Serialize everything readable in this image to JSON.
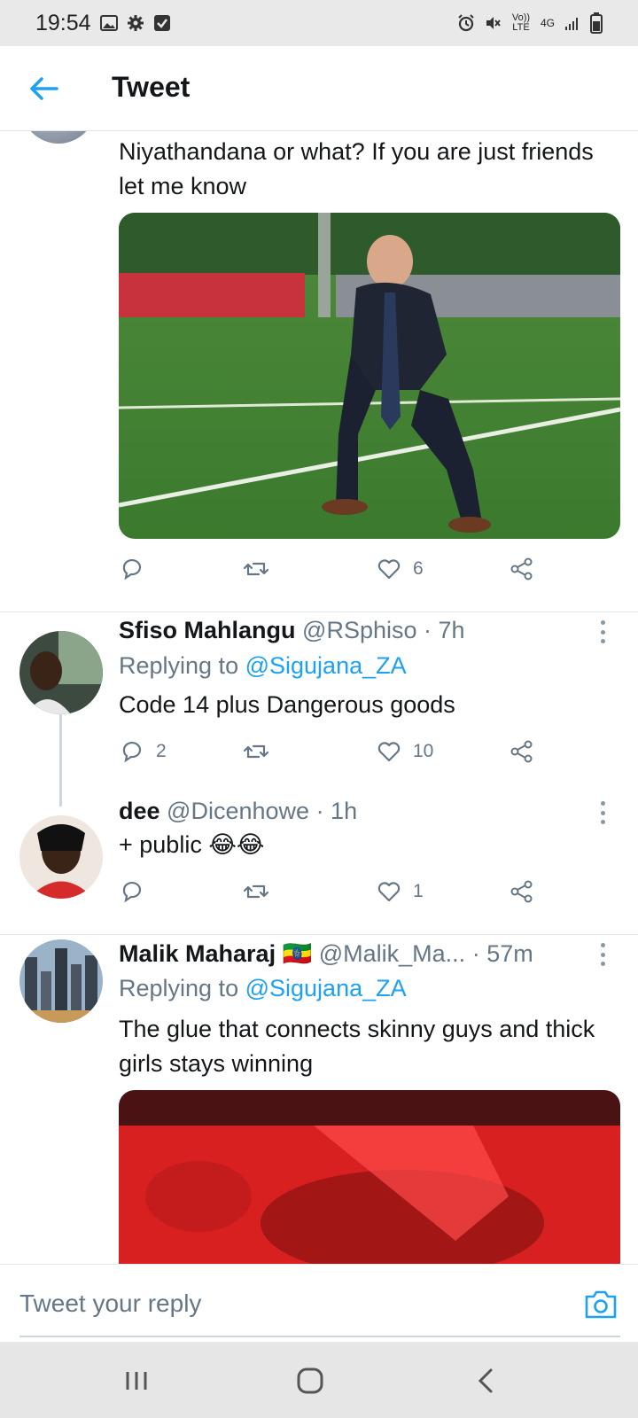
{
  "status_bar": {
    "time": "19:54",
    "network": "4G",
    "volte": "Vo)) LTE",
    "icons": [
      "image-icon",
      "gear-icon",
      "check-box-icon",
      "alarm-icon",
      "mute-icon",
      "signal-icon",
      "battery-icon"
    ]
  },
  "header": {
    "title": "Tweet",
    "back_icon": "arrow-left-icon",
    "accent": "#1da1f2"
  },
  "tweets": [
    {
      "text": "Niyathandana or what? If you are just friends let me know",
      "has_media": true,
      "reply_count": "",
      "retweet_count": "",
      "like_count": "6"
    },
    {
      "name": "Sfiso Mahlangu",
      "handle": "@RSphiso",
      "time": "· 7h",
      "replying_prefix": "Replying to",
      "replying_to": "@Sigujana_ZA",
      "text": "Code 14 plus Dangerous goods",
      "reply_count": "2",
      "retweet_count": "",
      "like_count": "10"
    },
    {
      "name": "dee",
      "handle": "@Dicenhowe",
      "time": "· 1h",
      "text": "+ public 😂😂",
      "reply_count": "",
      "retweet_count": "",
      "like_count": "1"
    },
    {
      "name": "Malik Maharaj",
      "flag": "🇪🇹",
      "handle": "@Malik_Ma...",
      "time": "· 57m",
      "replying_prefix": "Replying to",
      "replying_to": "@Sigujana_ZA",
      "text": "The glue that connects skinny guys and thick girls stays winning",
      "has_media": true
    }
  ],
  "reply_bar": {
    "placeholder": "Tweet your reply",
    "camera_icon": "camera-icon"
  },
  "nav_bar": {
    "buttons": [
      "recent-apps-icon",
      "home-icon",
      "back-icon"
    ]
  }
}
